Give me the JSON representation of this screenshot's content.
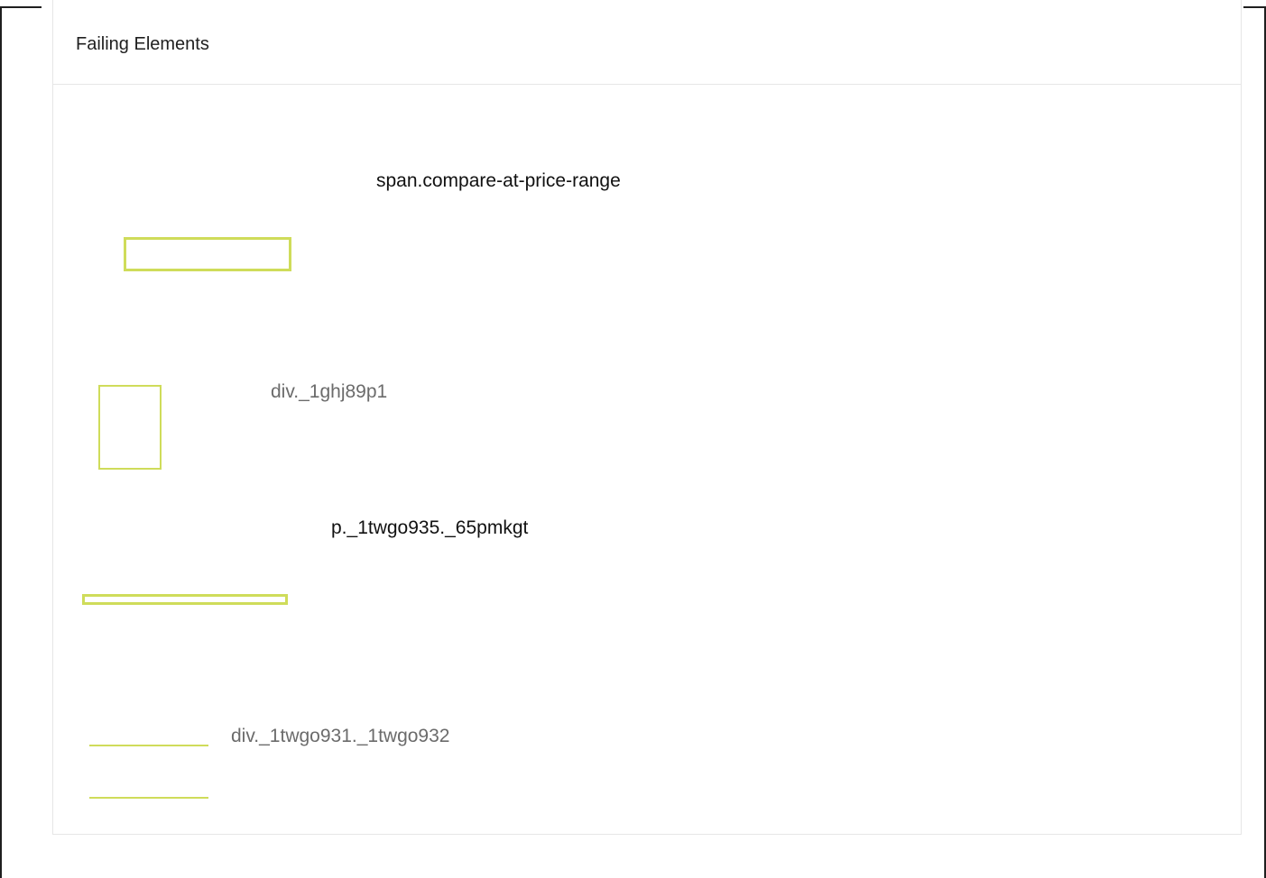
{
  "panel": {
    "title": "Failing Elements"
  },
  "elements": [
    {
      "selector": "span.compare-at-price-range"
    },
    {
      "selector": "div._1ghj89p1"
    },
    {
      "selector": "p._1twgo935._65pmkgt"
    },
    {
      "selector": "div._1twgo931._1twgo932"
    }
  ],
  "colors": {
    "highlight": "#cfdc5a",
    "border": "#e6e6e6",
    "text_dark": "#111111",
    "text_muted": "#6b6b6b",
    "frame": "#1f1f1f"
  }
}
